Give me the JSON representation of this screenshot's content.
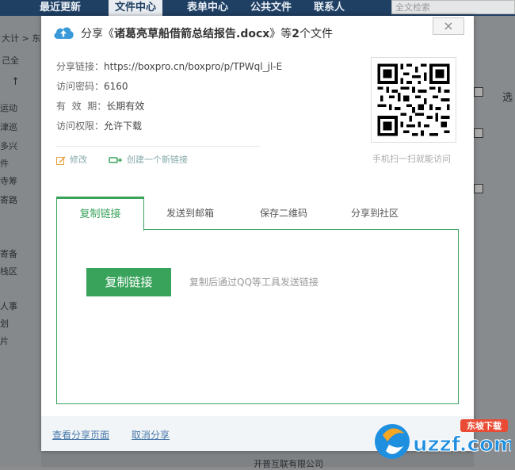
{
  "topnav": {
    "items": [
      {
        "label": "最近更新"
      },
      {
        "label": "文件中心"
      },
      {
        "label": "表单中心"
      },
      {
        "label": "公共文件"
      },
      {
        "label": "联系人"
      }
    ],
    "search_placeholder": "全文检索"
  },
  "background": {
    "breadcrumb": "大计 > 东",
    "fragment1": "己全",
    "left_items": [
      "运动",
      "津巡",
      "多兴",
      "件",
      "寺筹",
      "寄路",
      "寄备",
      "栈区",
      "人事",
      "划",
      "片"
    ],
    "right_label": "选",
    "footer": "开普互联有限公司"
  },
  "dialog": {
    "title_prefix": "分享《",
    "title_file": "诸葛亮草船借箭总结报告.docx",
    "title_suffix": "》等",
    "title_count": "2",
    "title_end": "个文件",
    "close_label": "×",
    "info": {
      "link_label": "分享链接：",
      "link_value": "https://boxpro.cn/boxpro/p/TPWql_jl-E",
      "password_label": "访问密码：",
      "password_value": "6160",
      "validity_label": "有  效  期：",
      "validity_value": "长期有效",
      "permission_label": "访问权限：",
      "permission_value": "允许下载"
    },
    "actions": {
      "edit": "修改",
      "new_link": "创建一个新链接"
    },
    "qr_caption": "手机扫一扫就能访问",
    "tabs": [
      {
        "label": "复制链接"
      },
      {
        "label": "发送到邮箱"
      },
      {
        "label": "保存二维码"
      },
      {
        "label": "分享到社区"
      }
    ],
    "copy_button": "复制链接",
    "copy_hint": "复制后通过QQ等工具发送链接",
    "footer": {
      "view_page": "查看分享页面",
      "cancel_share": "取消分享"
    }
  },
  "watermark": {
    "text": "uzzf.com",
    "tag": "东坡下载"
  },
  "colors": {
    "accent": "#3aa35b",
    "nav": "#1f3f63",
    "link": "#4a79a8"
  }
}
